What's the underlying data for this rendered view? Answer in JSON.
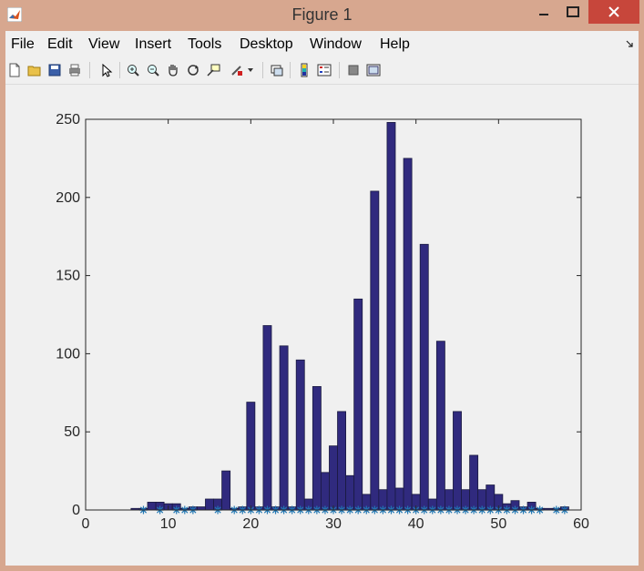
{
  "window": {
    "title": "Figure 1"
  },
  "menu": {
    "items": [
      "File",
      "Edit",
      "View",
      "Insert",
      "Tools",
      "Desktop",
      "Window",
      "Help"
    ]
  },
  "toolbar": {
    "icons": [
      "new-figure-icon",
      "open-file-icon",
      "save-icon",
      "print-icon",
      "edit-plot-icon",
      "zoom-in-icon",
      "zoom-out-icon",
      "pan-icon",
      "rotate-3d-icon",
      "data-cursor-icon",
      "brush-icon",
      "brush-dropdown-icon",
      "link-plot-icon",
      "colorbar-icon",
      "legend-icon",
      "hide-plot-tools-icon",
      "show-plot-tools-icon"
    ]
  },
  "chart_data": {
    "type": "bar",
    "xlim": [
      0,
      60
    ],
    "ylim": [
      0,
      250
    ],
    "xticks": [
      0,
      10,
      20,
      30,
      40,
      50,
      60
    ],
    "yticks": [
      0,
      50,
      100,
      150,
      200,
      250
    ],
    "grid": false,
    "bar_color": "#302a7e",
    "marker_color": "#1f77b4",
    "bins": [
      {
        "x": 6,
        "y": 1
      },
      {
        "x": 7,
        "y": 1
      },
      {
        "x": 8,
        "y": 5
      },
      {
        "x": 9,
        "y": 5
      },
      {
        "x": 10,
        "y": 4
      },
      {
        "x": 11,
        "y": 4
      },
      {
        "x": 12,
        "y": 1
      },
      {
        "x": 13,
        "y": 2
      },
      {
        "x": 14,
        "y": 2
      },
      {
        "x": 15,
        "y": 7
      },
      {
        "x": 16,
        "y": 7
      },
      {
        "x": 17,
        "y": 25
      },
      {
        "x": 18,
        "y": 1
      },
      {
        "x": 19,
        "y": 2
      },
      {
        "x": 20,
        "y": 69
      },
      {
        "x": 21,
        "y": 2
      },
      {
        "x": 22,
        "y": 118
      },
      {
        "x": 23,
        "y": 2
      },
      {
        "x": 24,
        "y": 105
      },
      {
        "x": 25,
        "y": 2
      },
      {
        "x": 26,
        "y": 96
      },
      {
        "x": 27,
        "y": 7
      },
      {
        "x": 28,
        "y": 79
      },
      {
        "x": 29,
        "y": 24
      },
      {
        "x": 30,
        "y": 41
      },
      {
        "x": 31,
        "y": 63
      },
      {
        "x": 32,
        "y": 22
      },
      {
        "x": 33,
        "y": 135
      },
      {
        "x": 34,
        "y": 10
      },
      {
        "x": 35,
        "y": 204
      },
      {
        "x": 36,
        "y": 13
      },
      {
        "x": 37,
        "y": 248
      },
      {
        "x": 38,
        "y": 14
      },
      {
        "x": 39,
        "y": 225
      },
      {
        "x": 40,
        "y": 10
      },
      {
        "x": 41,
        "y": 170
      },
      {
        "x": 42,
        "y": 7
      },
      {
        "x": 43,
        "y": 108
      },
      {
        "x": 44,
        "y": 13
      },
      {
        "x": 45,
        "y": 63
      },
      {
        "x": 46,
        "y": 13
      },
      {
        "x": 47,
        "y": 35
      },
      {
        "x": 48,
        "y": 13
      },
      {
        "x": 49,
        "y": 16
      },
      {
        "x": 50,
        "y": 10
      },
      {
        "x": 51,
        "y": 4
      },
      {
        "x": 52,
        "y": 6
      },
      {
        "x": 53,
        "y": 2
      },
      {
        "x": 54,
        "y": 5
      },
      {
        "x": 55,
        "y": 1
      },
      {
        "x": 56,
        "y": 1
      },
      {
        "x": 57,
        "y": 1
      },
      {
        "x": 58,
        "y": 2
      }
    ],
    "markers_x": [
      7,
      9,
      11,
      12,
      13,
      16,
      18,
      19,
      20,
      21,
      22,
      23,
      24,
      25,
      26,
      27,
      28,
      29,
      30,
      31,
      32,
      33,
      34,
      35,
      36,
      37,
      38,
      39,
      40,
      41,
      42,
      43,
      44,
      45,
      46,
      47,
      48,
      49,
      50,
      51,
      52,
      53,
      54,
      55,
      57,
      58
    ]
  }
}
